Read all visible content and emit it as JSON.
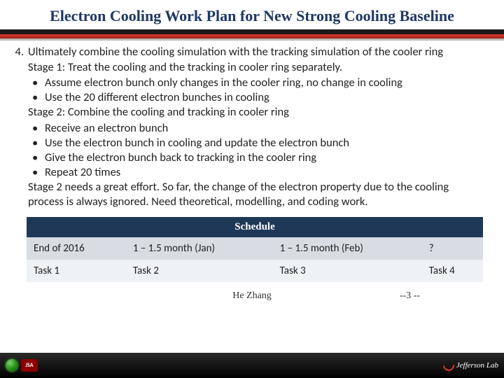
{
  "title": "Electron Cooling Work Plan for New Strong Cooling Baseline",
  "item_number": "4.",
  "paragraphs": {
    "intro": "Ultimately combine the cooling simulation with the tracking simulation of the cooler ring",
    "stage1_label": "Stage 1: Treat the cooling and the tracking in cooler ring separately.",
    "stage1_bullets": [
      "Assume electron bunch only changes in the cooler ring, no change in cooling",
      "Use the 20 different electron bunches in cooling"
    ],
    "stage2_label": "Stage 2: Combine the cooling and tracking in cooler ring",
    "stage2_bullets": [
      "Receive an electron bunch",
      "Use the electron bunch in cooling and update the electron bunch",
      "Give the electron bunch back to tracking in the cooler ring",
      "Repeat 20 times"
    ],
    "closing": "Stage 2 needs a great effort. So far, the change of the electron property due to the cooling process is always ignored. Need theoretical, modelling, and coding work."
  },
  "schedule": {
    "header": "Schedule",
    "rows": [
      [
        "End of 2016",
        "1 – 1.5 month (Jan)",
        "1 – 1.5 month (Feb)",
        "?"
      ],
      [
        "Task 1",
        "Task 2",
        "Task 3",
        "Task 4"
      ]
    ]
  },
  "footer": {
    "author": "He Zhang",
    "page": "--3 --",
    "jlab": "Jefferson Lab"
  }
}
